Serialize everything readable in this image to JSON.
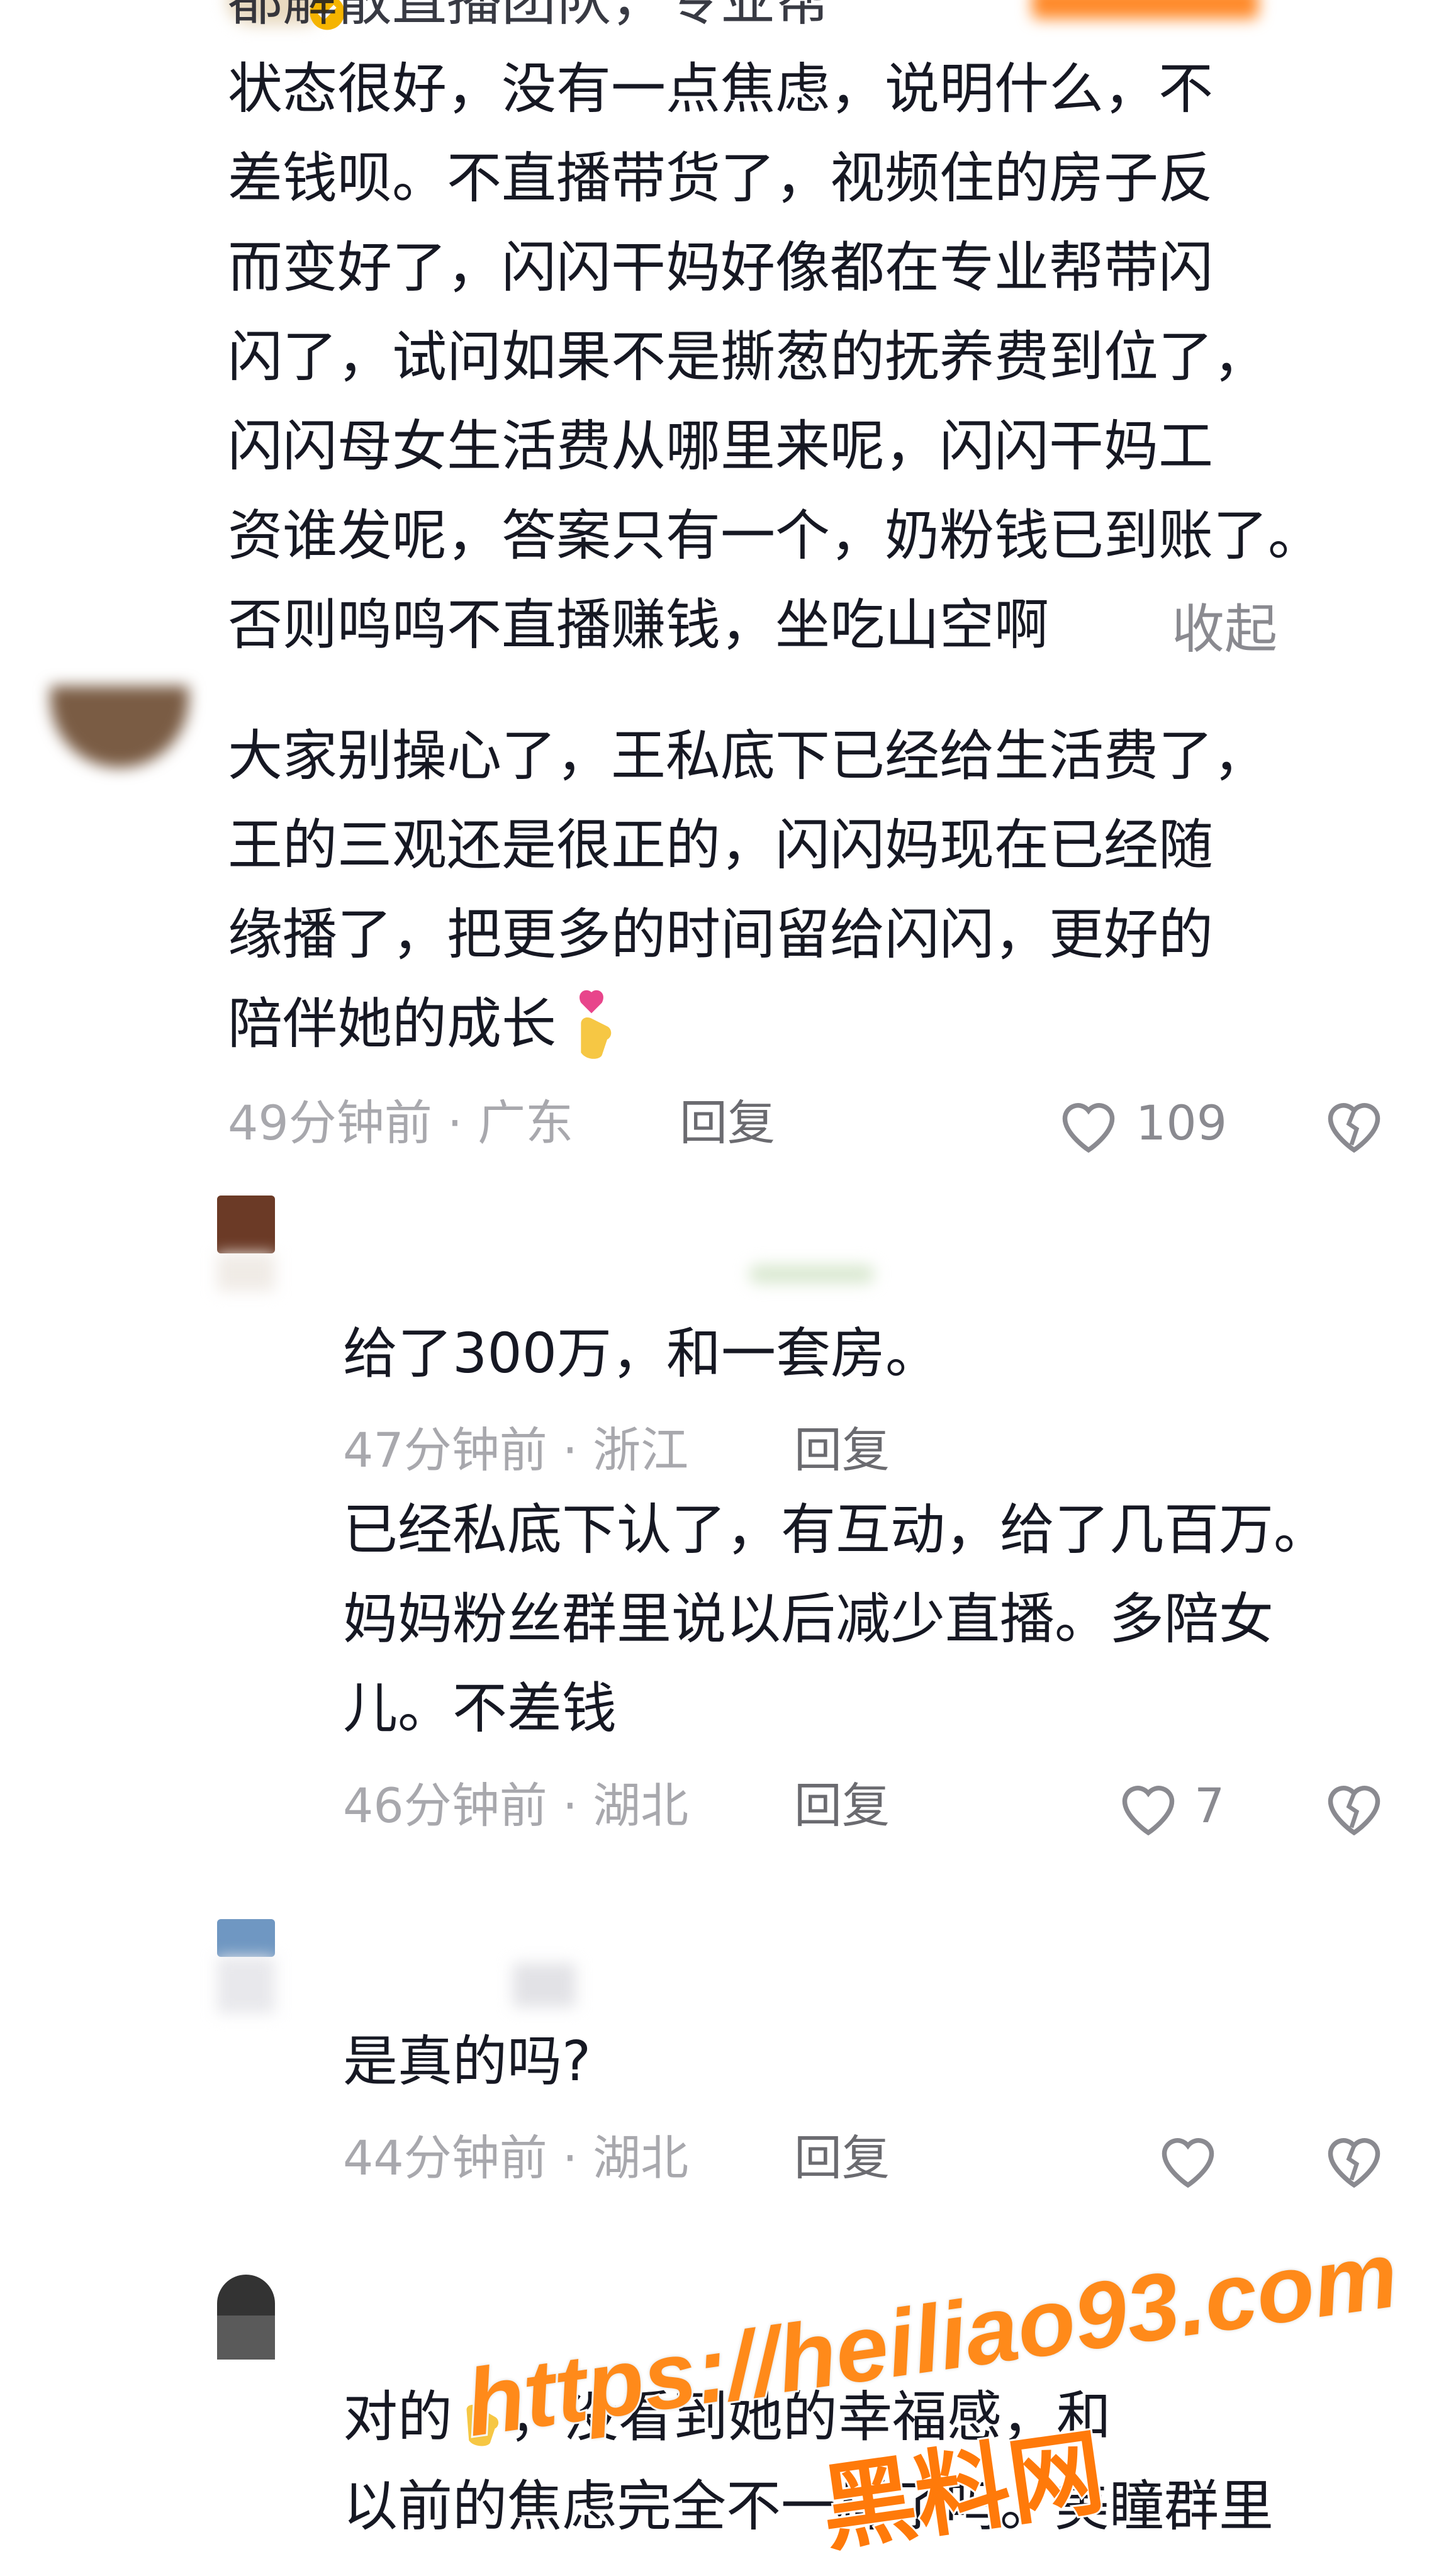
{
  "comments": [
    {
      "lines": [
        "状态很好，没有一点焦虑，说明什么，不",
        "差钱呗。不直播带货了，视频住的房子反",
        "而变好了，闪闪干妈好像都在专业帮带闪",
        "闪了，试问如果不是撕葱的抚养费到位了，",
        "闪闪母女生活费从哪里来呢，闪闪干妈工",
        "资谁发呢，答案只有一个，奶粉钱已到账了。",
        "否则鸣鸣不直播赚钱，坐吃山空啊"
      ],
      "collapse_label": "收起"
    },
    {
      "lines": [
        "大家别操心了，王私底下已经给生活费了，",
        "王的三观还是很正的，闪闪妈现在已经随",
        "缘播了，把更多的时间留给闪闪，更好的",
        "陪伴她的成长"
      ],
      "meta": "49分钟前 · 广东",
      "reply_label": "回复",
      "like_count": "109"
    }
  ],
  "replies": [
    {
      "text": "给了300万，和一套房。",
      "meta": "47分钟前 · 浙江",
      "reply_label": "回复"
    },
    {
      "lines": [
        "已经私底下认了，有互动，给了几百万。",
        "妈妈粉丝群里说以后减少直播。多陪女",
        "儿。不差钱"
      ],
      "meta": "46分钟前 · 湖北",
      "reply_label": "回复",
      "like_count": "7"
    },
    {
      "text": "是真的吗?",
      "meta": "44分钟前 · 湖北",
      "reply_label": "回复"
    },
    {
      "lines": [
        "对的",
        "以前的焦虑完全不一样了吗。美瞳群里"
      ],
      "line1_tail": "，没看到她的幸福感，和"
    }
  ],
  "watermark": {
    "url": "https://heiliao93.com",
    "brand": "黑料网"
  },
  "icons": {
    "like": "heart-icon",
    "dislike": "broken-heart-icon",
    "verified": "verified-badge-icon",
    "emoji": "finger-heart-emoji-icon"
  },
  "colors": {
    "text": "#161823",
    "meta": "#a8a8ad",
    "watermark": "#ff8a1a"
  }
}
